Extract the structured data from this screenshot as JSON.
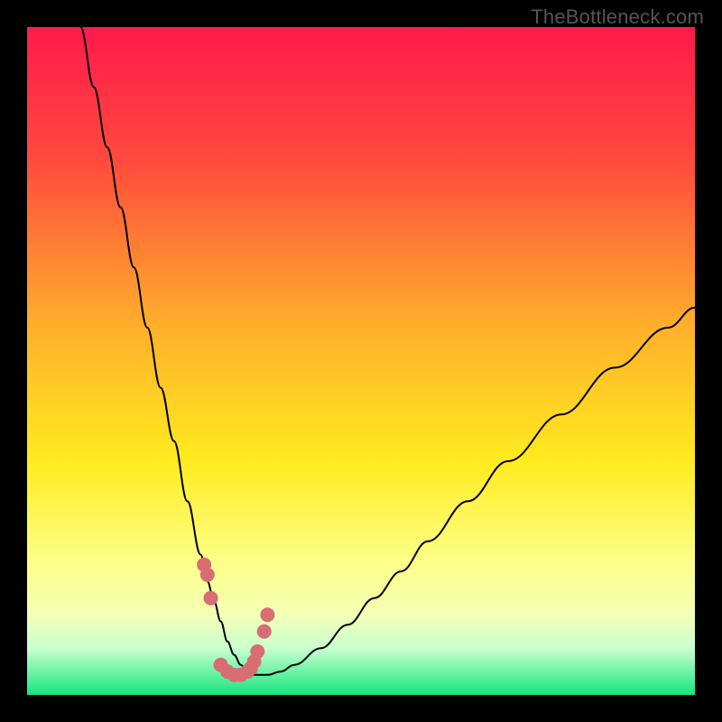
{
  "watermark": "TheBottleneck.com",
  "chart_data": {
    "type": "line",
    "title": "",
    "xlabel": "",
    "ylabel": "",
    "xlim": [
      0,
      100
    ],
    "ylim": [
      0,
      100
    ],
    "grid": false,
    "legend": false,
    "gradient_background": {
      "stops": [
        {
          "offset": 0,
          "color": "#ff1a4b"
        },
        {
          "offset": 20,
          "color": "#ff4a3e"
        },
        {
          "offset": 45,
          "color": "#ffb02a"
        },
        {
          "offset": 65,
          "color": "#ffeb1f"
        },
        {
          "offset": 80,
          "color": "#fdff88"
        },
        {
          "offset": 88,
          "color": "#f3ffb5"
        },
        {
          "offset": 93,
          "color": "#c9ffcf"
        },
        {
          "offset": 100,
          "color": "#15e57e"
        }
      ]
    },
    "series": [
      {
        "name": "bottleneck-curve",
        "color": "#000000",
        "width": 2,
        "x": [
          8,
          10,
          12,
          14,
          16,
          18,
          20,
          22,
          24,
          26,
          27,
          28,
          29,
          30,
          31,
          32,
          33,
          34,
          36,
          38,
          40,
          44,
          48,
          52,
          56,
          60,
          66,
          72,
          80,
          88,
          96,
          100
        ],
        "y": [
          100,
          91,
          82,
          73,
          64,
          55,
          46,
          38,
          29,
          21,
          17,
          14,
          11,
          8,
          6,
          4.5,
          3.5,
          3,
          3,
          3.5,
          4.5,
          7,
          10.5,
          14.5,
          18.5,
          23,
          29,
          35,
          42,
          49,
          55,
          58
        ]
      },
      {
        "name": "data-markers",
        "color": "#d86d74",
        "type": "scatter",
        "radius": 8,
        "x": [
          26.5,
          27.0,
          27.5,
          29.0,
          30.0,
          31.0,
          32.0,
          33.0,
          33.5,
          34.0,
          34.5,
          35.5,
          36.0
        ],
        "y": [
          19.5,
          18.0,
          14.5,
          4.5,
          3.5,
          3.0,
          3.0,
          3.5,
          4.0,
          5.0,
          6.5,
          9.5,
          12.0
        ]
      }
    ]
  }
}
